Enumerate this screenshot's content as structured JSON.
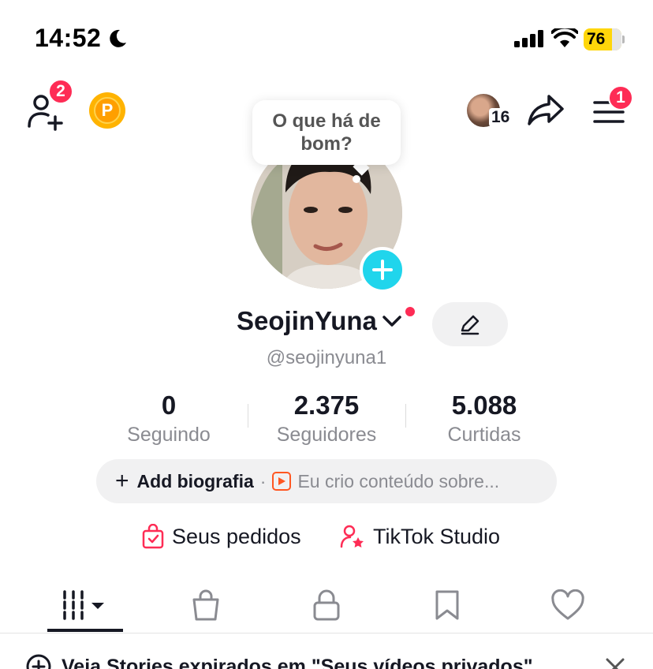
{
  "status_bar": {
    "time": "14:52",
    "battery": "76",
    "battery_level_percent": 76
  },
  "header": {
    "friends_badge": "2",
    "menu_badge": "1",
    "profile_visitors_count": "16"
  },
  "tooltip": {
    "text": "O que há de bom?"
  },
  "profile": {
    "username": "SeojinYuna",
    "handle": "@seojinyuna1"
  },
  "stats": [
    {
      "value": "0",
      "label": "Seguindo"
    },
    {
      "value": "2.375",
      "label": "Seguidores"
    },
    {
      "value": "5.088",
      "label": "Curtidas"
    }
  ],
  "bio": {
    "plus": "+",
    "add_label": "Add biografia",
    "separator": "·",
    "suggestion": "Eu crio conteúdo sobre..."
  },
  "links": {
    "orders": "Seus pedidos",
    "studio": "TikTok Studio"
  },
  "tabs": [
    "videos-grid",
    "shop",
    "private",
    "saved",
    "liked"
  ],
  "banner": {
    "text": "Veja Stories expirados em \"Seus vídeos privados\""
  },
  "colors": {
    "accent_red": "#fe2c55",
    "cyan": "#20d5ec",
    "coin": "#ffb300",
    "battery": "#ffd60a"
  },
  "icons": {
    "status": [
      "moon-icon",
      "signal-icon",
      "wifi-icon",
      "battery-icon"
    ],
    "header": [
      "add-friend-icon",
      "coin-icon",
      "share-icon",
      "menu-icon"
    ]
  }
}
